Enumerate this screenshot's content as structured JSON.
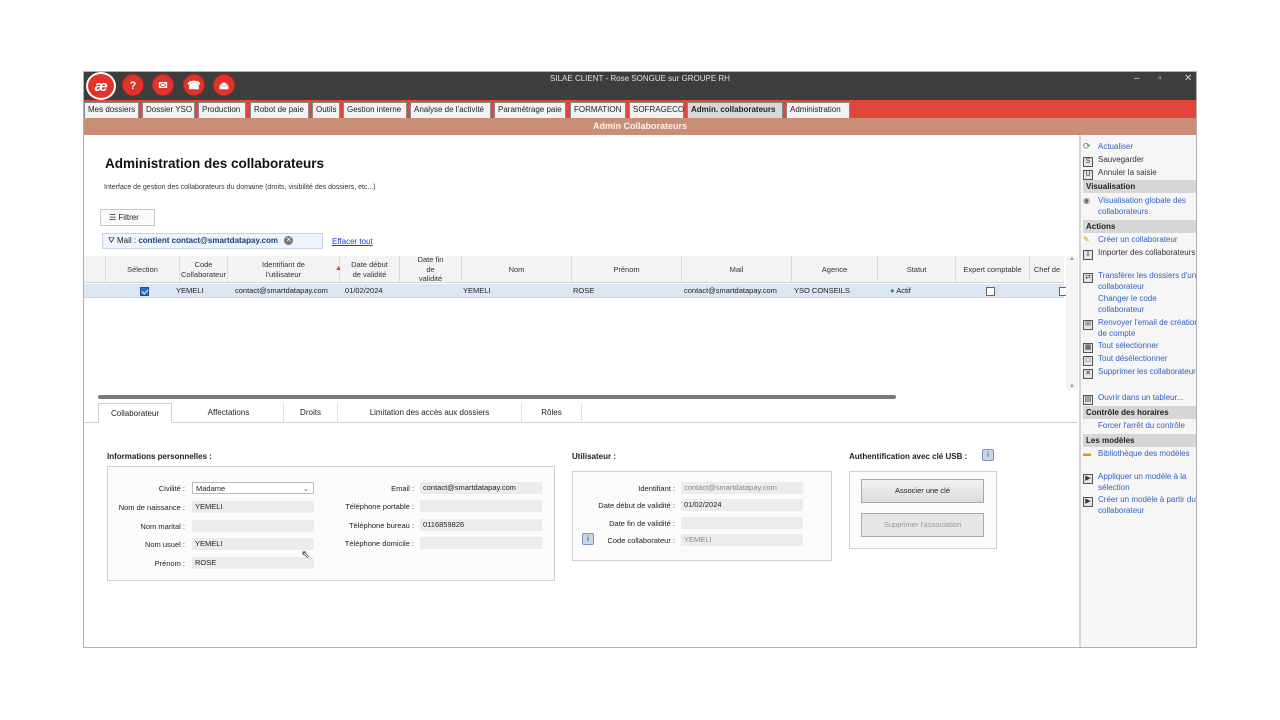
{
  "window": {
    "title": "SILAE CLIENT - Rose SONGUE sur GROUPE RH",
    "logo": "æ",
    "toolbar_icons": [
      "help-icon",
      "chat-icon",
      "notification-icon",
      "eject-icon"
    ],
    "controls": [
      "–",
      "▫",
      "✕"
    ]
  },
  "tabs": [
    {
      "label": "Mes dossiers"
    },
    {
      "label": "Dossier YSO"
    },
    {
      "label": "Production"
    },
    {
      "label": "Robot de paie"
    },
    {
      "label": "Outils"
    },
    {
      "label": "Gestion interne"
    },
    {
      "label": "Analyse de l'activité"
    },
    {
      "label": "Paramétrage paie"
    },
    {
      "label": "FORMATION"
    },
    {
      "label": "SOFRAGECO"
    },
    {
      "label": "Admin. collaborateurs",
      "active": true
    },
    {
      "label": "Administration"
    }
  ],
  "section_band": "Admin Collaborateurs",
  "page": {
    "title": "Administration des collaborateurs",
    "description": "Interface de gestion des collaborateurs du domaine (droits, visibilité des dossiers, etc...)",
    "filter_button": "Filtrer",
    "filter_chip": {
      "field": "Mail :",
      "value": "contient contact@smartdatapay.com"
    },
    "clear_all": "Effacer tout"
  },
  "grid": {
    "columns": [
      "Sélection",
      "Code Collaborateur",
      "Identifiant de l'utilisateur",
      "Date début de validité",
      "Date fin de validité",
      "Nom",
      "Prénom",
      "Mail",
      "Agence",
      "Statut",
      "Expert comptable",
      "Chef de"
    ],
    "rows": [
      {
        "selected": true,
        "code": "YEMELI",
        "identifiant": "contact@smartdatapay.com",
        "date_debut": "01/02/2024",
        "date_fin": "",
        "nom": "YEMELI",
        "prenom": "ROSE",
        "mail": "contact@smartdatapay.com",
        "agence": "YSO CONSEILS",
        "statut": "Actif",
        "expert_comptable": false
      }
    ]
  },
  "bottom_tabs": [
    "Collaborateur",
    "Affectations",
    "Droits",
    "Limitation des accès aux dossiers",
    "Rôles"
  ],
  "personal": {
    "heading": "Informations personnelles :",
    "civilite_label": "Civilité :",
    "civilite": "Madame",
    "nom_naissance_label": "Nom de naissance :",
    "nom_naissance": "YEMELI",
    "nom_marital_label": "Nom marital :",
    "nom_marital": "",
    "nom_usuel_label": "Nom usuel :",
    "nom_usuel": "YEMELI",
    "prenom_label": "Prénom :",
    "prenom": "ROSE",
    "email_label": "Email :",
    "email": "contact@smartdatapay.com",
    "tel_portable_label": "Téléphone portable :",
    "tel_portable": "",
    "tel_bureau_label": "Téléphone bureau :",
    "tel_bureau": "0116859826",
    "tel_domicile_label": "Téléphone domicile :",
    "tel_domicile": ""
  },
  "user": {
    "heading": "Utilisateur :",
    "identifiant_label": "Identifiant :",
    "identifiant": "contact@smartdatapay.com",
    "date_debut_label": "Date début de validité :",
    "date_debut": "01/02/2024",
    "date_fin_label": "Date fin de validité :",
    "date_fin": "",
    "code_label": "Code collaborateur :",
    "code": "YEMELI"
  },
  "usb": {
    "heading": "Authentification avec clé USB :",
    "associate": "Associer une clé",
    "remove": "Supprimer l'association"
  },
  "right_panel": {
    "refresh": "Actualiser",
    "save": "Sauvegarder",
    "cancel": "Annuler la saisie",
    "visualisation_heading": "Visualisation",
    "global_view": "Visualisation globale des collaborateurs",
    "actions_heading": "Actions",
    "create": "Créer un collaborateur",
    "import": "Importer des collaborateurs",
    "transfer": "Transférer les dossiers d'un collaborateur",
    "change_code": "Changer le code collaborateur",
    "resend_email": "Renvoyer l'email de création de compte",
    "select_all": "Tout sélectionner",
    "deselect_all": "Tout désélectionner",
    "delete": "Supprimer les collaborateurs",
    "open_table": "Ouvrir dans un tableur...",
    "hours_heading": "Contrôle des horaires",
    "force_stop": "Forcer l'arrêt du contrôle",
    "models_heading": "Les modèles",
    "library": "Bibliothèque des modèles",
    "apply_model": "Appliquer un modèle à la sélection",
    "create_model": "Créer un modèle à partir du collaborateur"
  }
}
